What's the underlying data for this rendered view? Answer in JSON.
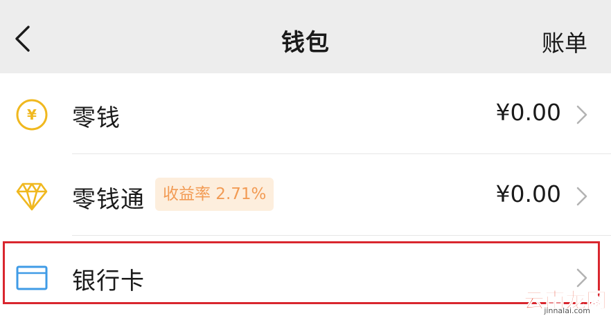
{
  "header": {
    "title": "钱包",
    "right_link": "账单"
  },
  "rows": [
    {
      "label": "零钱",
      "amount": "¥0.00",
      "icon": "yuan-coin-icon"
    },
    {
      "label": "零钱通",
      "badge": "收益率 2.71%",
      "amount": "¥0.00",
      "icon": "diamond-icon"
    },
    {
      "label": "银行卡",
      "icon": "bank-card-icon"
    }
  ],
  "watermark": {
    "text": "云南龙网",
    "sub": "jinnalai.com"
  },
  "colors": {
    "header_bg": "#ededed",
    "coin_yellow": "#f0b81f",
    "card_blue": "#3f9be6",
    "badge_bg": "#fdeedd",
    "badge_text": "#f29b54",
    "highlight_border": "#d9262e",
    "watermark_red": "#e63a1f"
  }
}
